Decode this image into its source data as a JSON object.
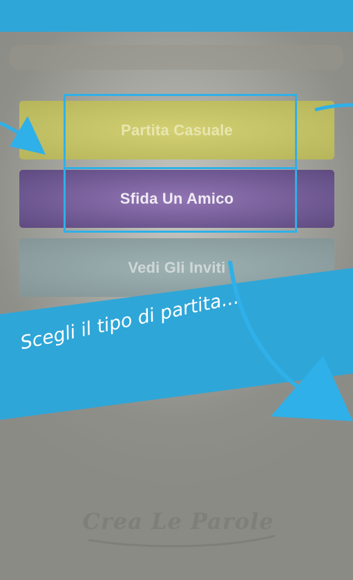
{
  "menu": {
    "random_match_label": "Partita Casuale",
    "challenge_friend_label": "Sfida Un Amico",
    "view_invites_label": "Vedi Gli Inviti"
  },
  "tutorial": {
    "banner_text": "Scegli il tipo di partita..."
  },
  "branding": {
    "logo_text": "Crea Le Parole"
  },
  "colors": {
    "accent_blue": "#2fa6d8",
    "random_match": "#c9c76a",
    "challenge_friend": "#7d63a0",
    "view_invites": "#8fa2a4"
  }
}
